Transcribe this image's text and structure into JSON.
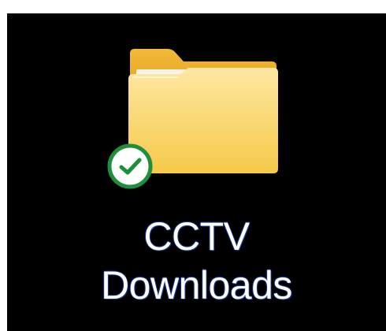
{
  "desktop": {
    "background_color": "#000000",
    "icon": {
      "type": "folder-icon",
      "folder_color": "#f8d46a",
      "status": "sync-check-icon",
      "status_color": "#1e8f3b",
      "label_lines": [
        "CCTV",
        "Downloads"
      ]
    }
  }
}
